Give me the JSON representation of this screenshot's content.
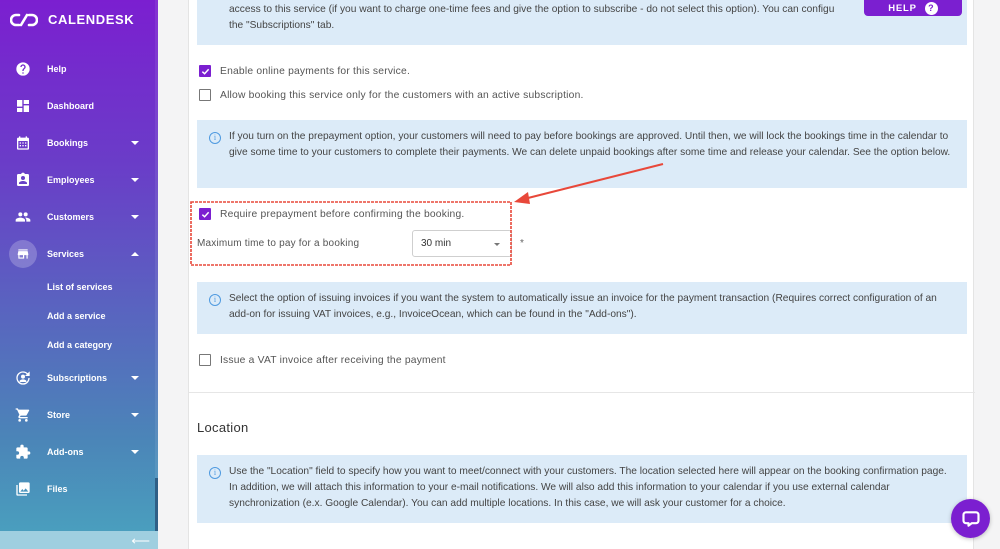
{
  "app": {
    "name": "CALENDESK"
  },
  "sidebar": {
    "items": [
      {
        "label": "Help",
        "icon": "help-circle-icon",
        "expandable": false
      },
      {
        "label": "Dashboard",
        "icon": "dashboard-icon",
        "expandable": false
      },
      {
        "label": "Bookings",
        "icon": "calendar-icon",
        "expandable": true
      },
      {
        "label": "Employees",
        "icon": "badge-icon",
        "expandable": true
      },
      {
        "label": "Customers",
        "icon": "people-icon",
        "expandable": true
      },
      {
        "label": "Services",
        "icon": "store-icon",
        "expandable": true,
        "expanded": true,
        "active": true
      },
      {
        "label": "Subscriptions",
        "icon": "subscription-icon",
        "expandable": true
      },
      {
        "label": "Store",
        "icon": "cart-icon",
        "expandable": true
      },
      {
        "label": "Add-ons",
        "icon": "puzzle-icon",
        "expandable": true
      },
      {
        "label": "Files",
        "icon": "images-icon",
        "expandable": false
      }
    ],
    "services_subitems": [
      "List of services",
      "Add a service",
      "Add a category"
    ],
    "collapse_icon": "arrow-left-icon"
  },
  "help_button": {
    "label": "HELP",
    "icon": "?"
  },
  "content": {
    "subscription_info": {
      "line1": "access to this service (if you want to charge one-time fees and give the option to subscribe - do not select this option). You can configu",
      "line2": "the \"Subscriptions\" tab."
    },
    "enable_online_payments": {
      "label": "Enable online payments for this service.",
      "checked": true
    },
    "subscription_only": {
      "label": "Allow booking this service only for the customers with an active subscription.",
      "checked": false
    },
    "prepayment_info": "If you turn on the prepayment option, your customers will need to pay before bookings are approved. Until then, we will lock the bookings time in the calendar to give some time to your customers to complete their payments. We can delete unpaid bookings after some time and release your calendar. See the option below.",
    "require_prepayment": {
      "label": "Require prepayment before confirming the booking.",
      "checked": true
    },
    "max_time": {
      "label": "Maximum time to pay for a booking",
      "value": "30 min",
      "required_mark": "*"
    },
    "invoice_info": "Select the option of issuing invoices if you want the system to automatically issue an invoice for the payment transaction (Requires correct configuration of an add-on for issuing VAT invoices, e.g., InvoiceOcean, which can be found in the \"Add-ons\").",
    "issue_vat": {
      "label": "Issue a VAT invoice after receiving the payment",
      "checked": false
    },
    "location_title": "Location",
    "location_info": "Use the \"Location\" field to specify how you want to meet/connect with your customers. The location selected here will appear on the booking confirmation page. In addition, we will attach this information to your e-mail notifications. We will also add this information to your calendar if you use external calendar synchronization (e.x. Google Calendar). You can add multiple locations. In this case, we will ask your customer for a choice."
  },
  "colors": {
    "brand": "#7b1fd0",
    "info_bg": "#dcebf8",
    "annotation": "#e8483a"
  }
}
